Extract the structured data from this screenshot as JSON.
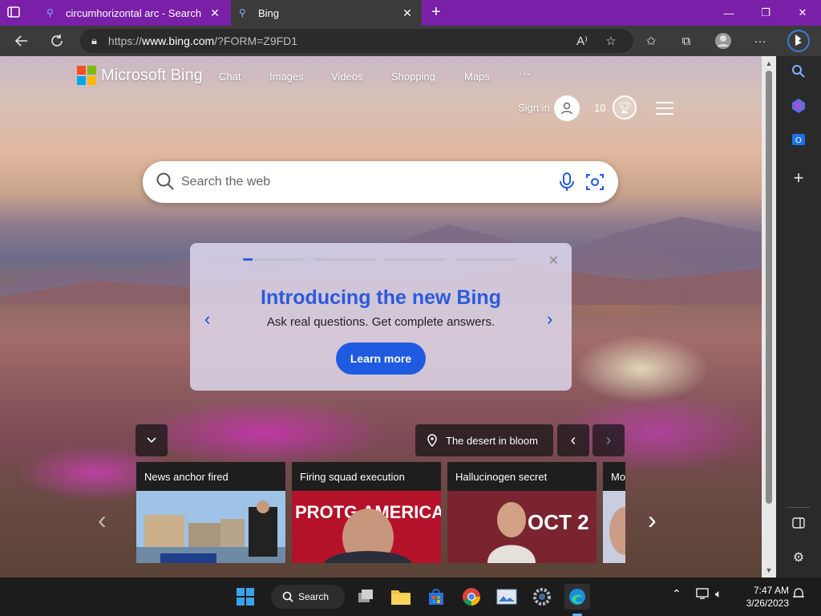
{
  "tabs": [
    {
      "label": "circumhorizontal arc - Search",
      "close": "✕",
      "icon": "search-icon"
    },
    {
      "label": "Bing",
      "close": "✕",
      "icon": "search-icon",
      "active": true
    }
  ],
  "window_controls": {
    "minimize": "—",
    "restore": "❐",
    "close": "✕"
  },
  "address": {
    "prefix": "https://",
    "host": "www.bing.com",
    "path": "/?FORM=Z9FD1"
  },
  "bing": {
    "brand": "Microsoft Bing",
    "nav": [
      "Chat",
      "Images",
      "Videos",
      "Shopping",
      "Maps",
      "···"
    ],
    "signin": "Sign in",
    "points": "10",
    "search_placeholder": "Search the web"
  },
  "promo": {
    "title": "Introducing the new Bing",
    "subtitle": "Ask real questions. Get complete answers.",
    "button": "Learn more",
    "close": "✕",
    "prev": "‹",
    "next": "›"
  },
  "image_caption": "The desert in bloom",
  "news_cards": [
    {
      "caption": "News anchor fired"
    },
    {
      "caption": "Firing squad execution"
    },
    {
      "caption": "Hallucinogen secret"
    },
    {
      "caption": "Mo"
    }
  ],
  "news_image_text": {
    "card2": "PROTG AMERICA",
    "card3": "OCT 2"
  },
  "taskbar": {
    "search_label": "Search"
  },
  "clock": {
    "time": "7:47 AM",
    "date": "3/26/2023"
  },
  "colors": {
    "tab_bar": "#7a1fa8",
    "bing_blue": "#2a5bdb",
    "button_blue": "#1f5be0"
  }
}
